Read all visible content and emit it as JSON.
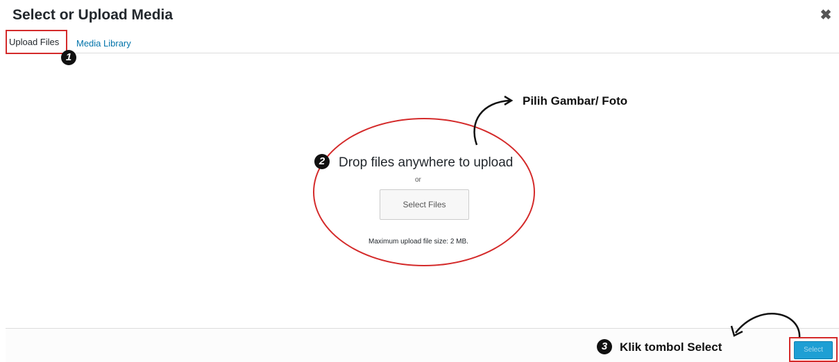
{
  "modal": {
    "title": "Select or Upload Media",
    "close_icon": "close-icon"
  },
  "tabs": [
    {
      "label": "Upload Files",
      "active": true
    },
    {
      "label": "Media Library",
      "active": false
    }
  ],
  "uploader": {
    "drop_text": "Drop files anywhere to upload",
    "or_text": "or",
    "select_files_label": "Select Files",
    "max_size_text": "Maximum upload file size: 2 MB."
  },
  "footer": {
    "select_label": "Select"
  },
  "annotations": {
    "step1": "1",
    "step2": "2",
    "step3": "3",
    "pick_image_note": "Pilih Gambar/ Foto",
    "click_select_note": "Klik tombol Select"
  },
  "colors": {
    "accent_blue": "#0073aa",
    "select_button": "#1e9fd4",
    "annotation_red": "#d42a2a"
  }
}
